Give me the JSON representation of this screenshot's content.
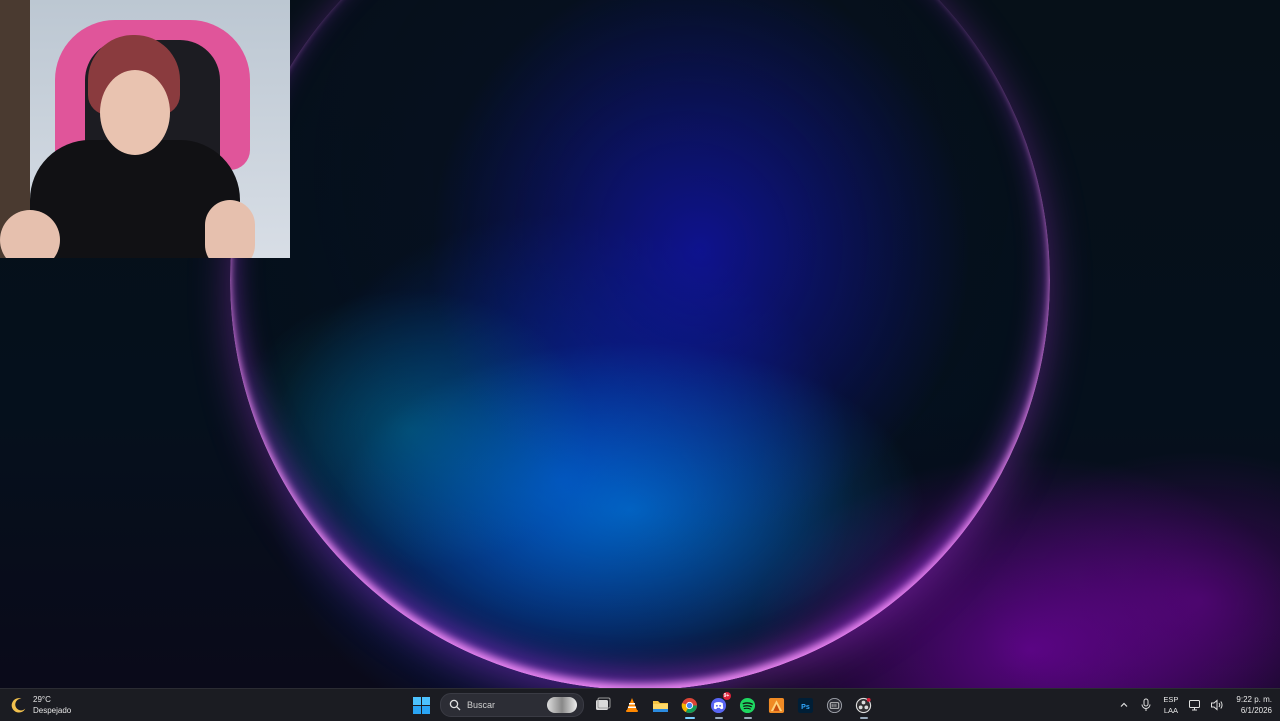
{
  "desktop": {
    "wallpaper": "windows-11-bloom",
    "accent_colors": [
      "#0046ff",
      "#9a00d2",
      "#ff96ff"
    ]
  },
  "webcam": {
    "description_icon": "webcam-overlay"
  },
  "taskbar": {
    "weather": {
      "temp": "29°C",
      "condition": "Despejado",
      "icon": "moon-icon"
    },
    "search": {
      "placeholder": "Buscar"
    },
    "apps": [
      {
        "name": "start-button",
        "icon": "windows-logo-icon"
      },
      {
        "name": "task-view",
        "icon": "task-view-icon"
      },
      {
        "name": "vlc",
        "icon": "vlc-cone-icon"
      },
      {
        "name": "file-explorer",
        "icon": "folder-icon"
      },
      {
        "name": "chrome",
        "icon": "chrome-icon",
        "active": true
      },
      {
        "name": "discord",
        "icon": "discord-icon",
        "badge": "9+"
      },
      {
        "name": "spotify",
        "icon": "spotify-icon"
      },
      {
        "name": "affinity",
        "icon": "affinity-icon"
      },
      {
        "name": "photoshop",
        "icon": "photoshop-icon",
        "label": "Ps"
      },
      {
        "name": "ssd-tool",
        "icon": "ssd-icon"
      },
      {
        "name": "obs",
        "icon": "obs-icon"
      }
    ],
    "tray": {
      "language_top": "ESP",
      "language_bottom": "LAA",
      "time": "9:22 p. m.",
      "date": "6/1/2026"
    }
  }
}
